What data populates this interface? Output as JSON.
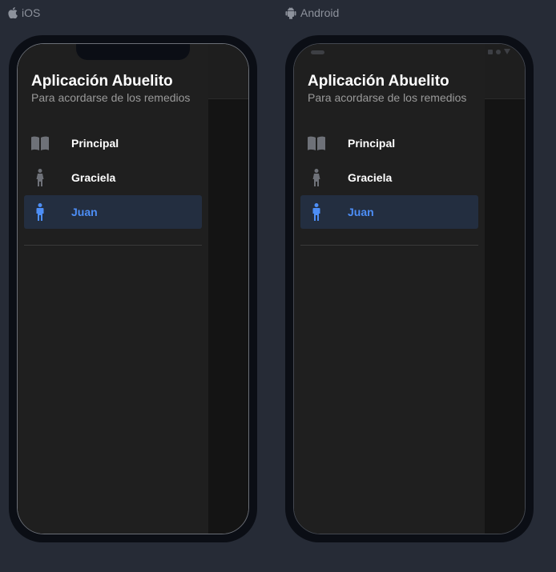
{
  "platforms": {
    "ios": {
      "label": "iOS"
    },
    "android": {
      "label": "Android"
    }
  },
  "drawer": {
    "title": "Aplicación Abuelito",
    "subtitle": "Para acordarse de los remedios",
    "items": [
      {
        "label": "Principal",
        "icon": "book-icon",
        "active": false
      },
      {
        "label": "Graciela",
        "icon": "female-icon",
        "active": false
      },
      {
        "label": "Juan",
        "icon": "male-icon",
        "active": true
      }
    ]
  },
  "colors": {
    "background": "#262b36",
    "drawer": "#1f1f1f",
    "active_bg": "#232e40",
    "active_text": "#4d8ef6",
    "icon_gray": "#6e7178"
  }
}
